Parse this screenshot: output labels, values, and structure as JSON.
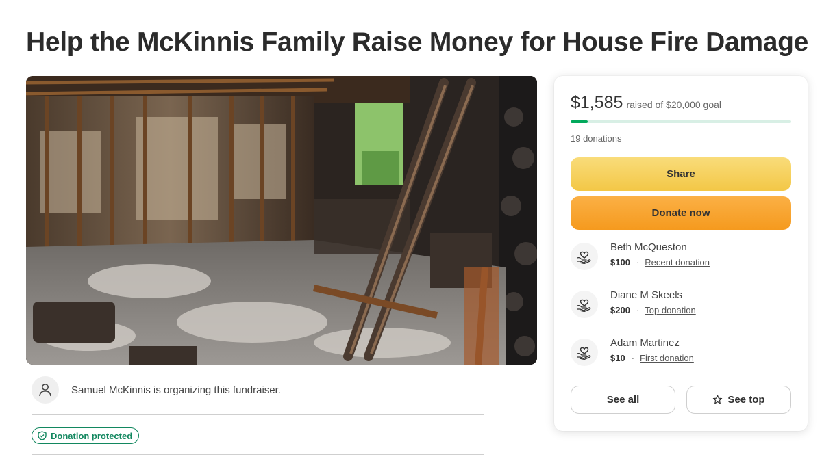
{
  "page": {
    "title": "Help the McKinnis Family Raise Money for House Fire Damage"
  },
  "hero": {
    "image_subject": "Interior of a house destroyed by fire: charred wall studs, ash and debris covering the floor, burned beams leaning in the foreground, greenery visible through a burned-out window"
  },
  "organizer": {
    "text": "Samuel McKinnis is organizing this fundraiser.",
    "icon": "user-icon"
  },
  "badge": {
    "label": "Donation protected",
    "icon": "shield-check-icon",
    "color": "#12875f"
  },
  "campaign": {
    "raised": "$1,585",
    "goal_text": "raised of $20,000 goal",
    "progress_fraction": 0.079,
    "donations": "19 donations",
    "progress_color": "#02a95c",
    "track_color": "#d8efe5"
  },
  "actions": {
    "share_label": "Share",
    "donate_label": "Donate now",
    "share_color": "#f3c746",
    "donate_color": "#f59a1e",
    "see_all_label": "See all",
    "see_top_label": "See top"
  },
  "donors": [
    {
      "name": "Beth McQueston",
      "amount": "$100",
      "tag": "Recent donation",
      "icon": "heart-hands-icon"
    },
    {
      "name": "Diane M Skeels",
      "amount": "$200",
      "tag": "Top donation",
      "icon": "heart-hands-icon"
    },
    {
      "name": "Adam Martinez",
      "amount": "$10",
      "tag": "First donation",
      "icon": "heart-hands-icon"
    }
  ]
}
